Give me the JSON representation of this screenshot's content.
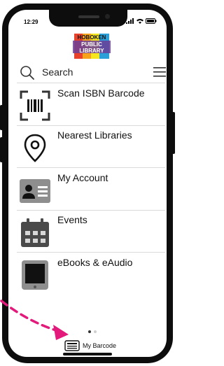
{
  "status_bar": {
    "time": "12:29"
  },
  "logo": {
    "line1": "HOBOKEN",
    "line2": "PUBLIC",
    "line3": "LIBRARY"
  },
  "search": {
    "label": "Search",
    "search_icon": "search-icon",
    "menu_icon": "hamburger-menu-icon"
  },
  "menu": [
    {
      "label": "Scan ISBN Barcode",
      "icon": "barcode-scan-icon"
    },
    {
      "label": "Nearest Libraries",
      "icon": "map-pin-icon"
    },
    {
      "label": "My Account",
      "icon": "id-card-icon"
    },
    {
      "label": "Events",
      "icon": "calendar-icon"
    },
    {
      "label": "eBooks & eAudio",
      "icon": "tablet-icon"
    }
  ],
  "page_indicator": {
    "pages": 2,
    "active": 1
  },
  "bottom_bar": {
    "label": "My Barcode",
    "icon": "barcode-card-icon"
  },
  "colors": {
    "annotation_arrow": "#e3197b",
    "icon_gray": "#8e8e8e",
    "frame": "#0d0d0d"
  }
}
